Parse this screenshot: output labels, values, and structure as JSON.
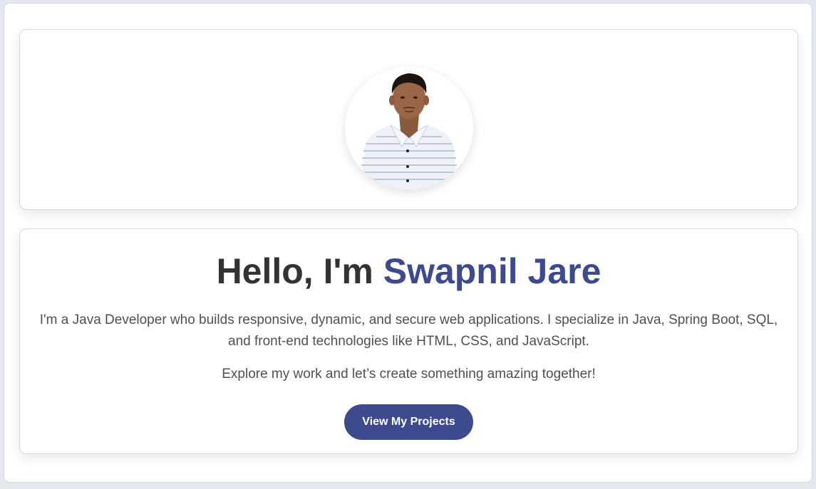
{
  "hero": {
    "heading_prefix": "Hello, I'm ",
    "name": "Swapnil Jare",
    "description": "I'm a Java Developer who builds responsive, dynamic, and secure web applications. I specialize in Java, Spring Boot, SQL, and front-end technologies like HTML, CSS, and JavaScript.",
    "tagline": "Explore my work and let’s create something amazing together!",
    "cta_label": "View My Projects"
  },
  "colors": {
    "accent": "#3d4a8e",
    "heading": "#333333",
    "body_text": "#505050"
  },
  "icons": {
    "profile_photo": "profile-photo"
  }
}
